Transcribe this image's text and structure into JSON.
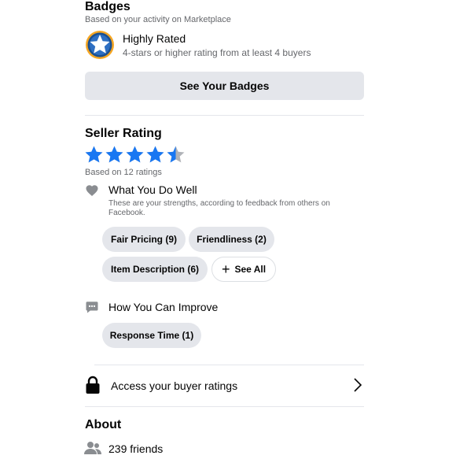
{
  "badges": {
    "title": "Badges",
    "subtitle": "Based on your activity on Marketplace",
    "badge_title": "Highly Rated",
    "badge_desc": "4-stars or higher rating from at least 4 buyers",
    "button_label": "See Your Badges"
  },
  "seller_rating": {
    "title": "Seller Rating",
    "rating_value": 4.5,
    "rating_max": 5,
    "based_on": "Based on 12 ratings",
    "well": {
      "title": "What You Do Well",
      "desc": "These are your strengths, according to feedback from others on Facebook.",
      "chips": [
        "Fair Pricing (9)",
        "Friendliness (2)",
        "Item Description (6)"
      ],
      "see_all": "See All"
    },
    "improve": {
      "title": "How You Can Improve",
      "chips": [
        "Response Time (1)"
      ]
    }
  },
  "buyer_ratings": {
    "label": "Access your buyer ratings"
  },
  "about": {
    "title": "About",
    "friends": "239 friends"
  },
  "colors": {
    "star": "#1877f2",
    "star_empty": "#b0b3b8",
    "chip_bg": "#e4e6eb"
  }
}
